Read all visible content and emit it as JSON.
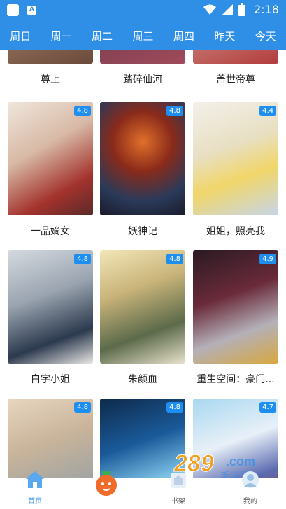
{
  "status_bar": {
    "time": "2:18"
  },
  "day_tabs": [
    "周日",
    "周一",
    "周二",
    "周三",
    "周四",
    "昨天",
    "今天"
  ],
  "comics": [
    {
      "title": "尊上",
      "rating": ""
    },
    {
      "title": "踏碎仙河",
      "rating": ""
    },
    {
      "title": "盖世帝尊",
      "rating": ""
    },
    {
      "title": "一品嫡女",
      "rating": "4.8"
    },
    {
      "title": "妖神记",
      "rating": "4.8"
    },
    {
      "title": "姐姐，照亮我",
      "rating": "4.4"
    },
    {
      "title": "白字小姐",
      "rating": "4.8"
    },
    {
      "title": "朱颜血",
      "rating": "4.8"
    },
    {
      "title": "重生空间：豪门...",
      "rating": "4.9"
    },
    {
      "title": "",
      "rating": "4.8"
    },
    {
      "title": "",
      "rating": "4.8"
    },
    {
      "title": "",
      "rating": "4.7"
    }
  ],
  "bottom_nav": {
    "home": "首页",
    "shelf": "书架",
    "mine": "我的"
  },
  "watermark": "289.com 手游网",
  "colors": {
    "accent": "#2f8fe6",
    "rating_badge": "#1e8ff0"
  }
}
